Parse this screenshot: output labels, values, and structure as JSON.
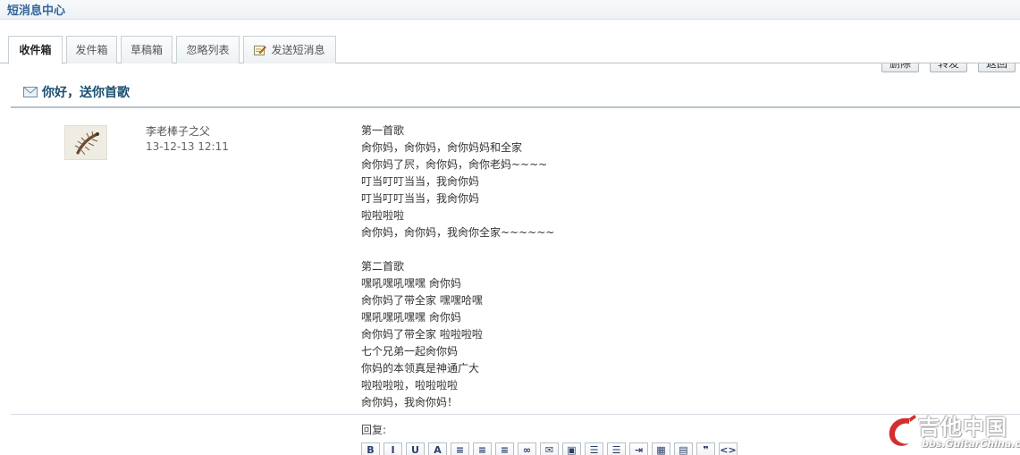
{
  "header": {
    "title": "短消息中心"
  },
  "tabs": [
    {
      "label": "收件箱",
      "active": true
    },
    {
      "label": "发件箱"
    },
    {
      "label": "草稿箱"
    },
    {
      "label": "忽略列表"
    },
    {
      "label": "发送短消息",
      "icon": "pen-icon"
    }
  ],
  "actions": {
    "delete": "删除",
    "forward": "转发",
    "back": "返回"
  },
  "message": {
    "subject": "你好，送你首歌",
    "sender": "李老棒子之父",
    "time": "13-12-13 12:11",
    "lines": [
      "第一首歌",
      "肏你妈，肏你妈，肏你妈妈和全家",
      "肏你妈了屄，肏你妈，肏你老妈~~~~",
      "叮当叮叮当当，我肏你妈",
      "叮当叮叮当当，我肏你妈",
      "啦啦啦啦",
      "肏你妈，肏你妈，我肏你全家~~~~~~",
      "",
      "第二首歌",
      "嘿吼嘿吼嘿嘿 肏你妈",
      "肏你妈了带全家 嘿嘿哈嘿",
      "嘿吼嘿吼嘿嘿 肏你妈",
      "肏你妈了带全家 啦啦啦啦",
      "七个兄弟一起肏你妈",
      "你妈的本领真是神通广大",
      "啦啦啦啦，啦啦啦啦",
      "肏你妈，我肏你妈！"
    ]
  },
  "reply": {
    "label": "回复:",
    "toolbar": [
      {
        "name": "bold-button",
        "glyph": "B"
      },
      {
        "name": "italic-button",
        "glyph": "I"
      },
      {
        "name": "underline-button",
        "glyph": "U"
      },
      {
        "name": "font-color-button",
        "glyph": "A"
      },
      {
        "name": "align-left-button",
        "glyph": "≡"
      },
      {
        "name": "align-center-button",
        "glyph": "≡"
      },
      {
        "name": "align-right-button",
        "glyph": "≡"
      },
      {
        "name": "link-button",
        "glyph": "∞"
      },
      {
        "name": "email-button",
        "glyph": "✉"
      },
      {
        "name": "image-button",
        "glyph": "▣"
      },
      {
        "name": "ordered-list-button",
        "glyph": "☰"
      },
      {
        "name": "unordered-list-button",
        "glyph": "☰"
      },
      {
        "name": "indent-button",
        "glyph": "⇥"
      },
      {
        "name": "insert-table-button",
        "glyph": "▦"
      },
      {
        "name": "insert-media-button",
        "glyph": "▤"
      },
      {
        "name": "quote-button",
        "glyph": "❞"
      },
      {
        "name": "code-button",
        "glyph": "<>"
      }
    ]
  },
  "watermark": {
    "text": "吉他中国",
    "url": "bbs.GuitarChina.com"
  },
  "colors": {
    "title": "#336699",
    "subject": "#1a4f72",
    "rule": "#b9c3c9"
  }
}
